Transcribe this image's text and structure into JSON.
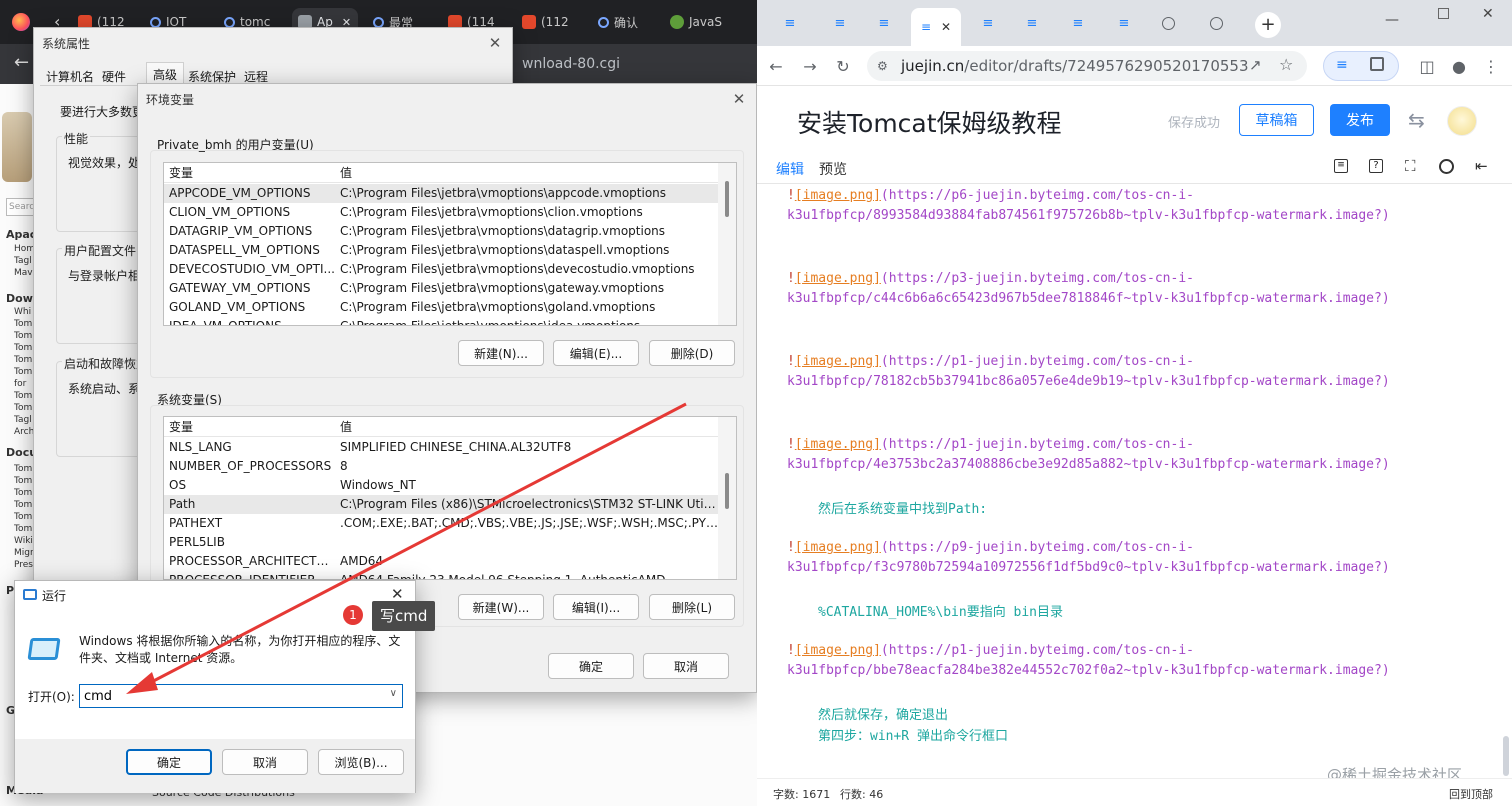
{
  "left_browser": {
    "tabs": [
      {
        "label": "(112",
        "icon": "c-icon"
      },
      {
        "label": "IOT",
        "icon": "g-icon"
      },
      {
        "label": "tomc",
        "icon": "g-icon"
      },
      {
        "label": "Ap",
        "icon": "page-icon"
      },
      {
        "label": "最常",
        "icon": "g-icon"
      },
      {
        "label": "(114",
        "icon": "c-icon"
      },
      {
        "label": "(112",
        "icon": "c-icon"
      },
      {
        "label": "确认",
        "icon": "g-icon"
      },
      {
        "label": "JavaS",
        "icon": "java-icon"
      }
    ],
    "address_fragment": "wnload-80.cgi",
    "sidebar_text": [
      "Apac",
      "Hom",
      "Tagl",
      "Mav",
      "Dow",
      "Whi",
      "Tom",
      "Tom",
      "Tom",
      "Tom",
      "Tom",
      "for",
      "Tom",
      "Tom",
      "Tagl",
      "Arch",
      "Docu",
      "Tom",
      "Tom",
      "Tom",
      "Tom",
      "Tom",
      "Tom",
      "Wiki",
      "Migr",
      "Pres",
      "P",
      "G",
      "Media"
    ],
    "search_placeholder": "Searc",
    "footer_fragment": "Source Code Distributions"
  },
  "system_properties": {
    "title": "系统属性",
    "tabs": [
      "计算机名",
      "硬件",
      "高级",
      "系统保护",
      "远程"
    ],
    "active_tab": "高级",
    "intro": "要进行大多数更",
    "performance": {
      "label": "性能",
      "text": "视觉效果，处"
    },
    "user_profiles": {
      "label": "用户配置文件",
      "text": "与登录帐户相"
    },
    "startup": {
      "label": "启动和故障恢复",
      "text": "系统启动、系"
    }
  },
  "env_vars": {
    "title": "环境变量",
    "user_section_label": "Private_bmh 的用户变量(U)",
    "columns": [
      "变量",
      "值"
    ],
    "user_vars": [
      {
        "name": "APPCODE_VM_OPTIONS",
        "value": "C:\\Program Files\\jetbra\\vmoptions\\appcode.vmoptions",
        "selected": true
      },
      {
        "name": "CLION_VM_OPTIONS",
        "value": "C:\\Program Files\\jetbra\\vmoptions\\clion.vmoptions"
      },
      {
        "name": "DATAGRIP_VM_OPTIONS",
        "value": "C:\\Program Files\\jetbra\\vmoptions\\datagrip.vmoptions"
      },
      {
        "name": "DATASPELL_VM_OPTIONS",
        "value": "C:\\Program Files\\jetbra\\vmoptions\\dataspell.vmoptions"
      },
      {
        "name": "DEVECOSTUDIO_VM_OPTI...",
        "value": "C:\\Program Files\\jetbra\\vmoptions\\devecostudio.vmoptions"
      },
      {
        "name": "GATEWAY_VM_OPTIONS",
        "value": "C:\\Program Files\\jetbra\\vmoptions\\gateway.vmoptions"
      },
      {
        "name": "GOLAND_VM_OPTIONS",
        "value": "C:\\Program Files\\jetbra\\vmoptions\\goland.vmoptions"
      },
      {
        "name": "IDEA_VM_OPTIONS",
        "value": "C:\\Program Files\\jetbra\\vmoptions\\idea.vmoptions"
      }
    ],
    "user_buttons": {
      "new": "新建(N)...",
      "edit": "编辑(E)...",
      "delete": "删除(D)"
    },
    "system_section_label": "系统变量(S)",
    "system_vars": [
      {
        "name": "NLS_LANG",
        "value": "SIMPLIFIED CHINESE_CHINA.AL32UTF8"
      },
      {
        "name": "NUMBER_OF_PROCESSORS",
        "value": "8"
      },
      {
        "name": "OS",
        "value": "Windows_NT"
      },
      {
        "name": "Path",
        "value": "C:\\Program Files (x86)\\STMicroelectronics\\STM32 ST-LINK Utili...",
        "selected": true
      },
      {
        "name": "PATHEXT",
        "value": ".COM;.EXE;.BAT;.CMD;.VBS;.VBE;.JS;.JSE;.WSF;.WSH;.MSC;.PY;.PYW"
      },
      {
        "name": "PERL5LIB",
        "value": ""
      },
      {
        "name": "PROCESSOR_ARCHITECTURE",
        "value": "AMD64"
      },
      {
        "name": "PROCESSOR_IDENTIFIER",
        "value": "AMD64 Family 23 Model 96 Stepping 1, AuthenticAMD"
      }
    ],
    "system_buttons": {
      "new": "新建(W)...",
      "edit": "编辑(I)...",
      "delete": "删除(L)"
    },
    "ok": "确定",
    "cancel": "取消"
  },
  "run_dialog": {
    "title": "运行",
    "description": "Windows 将根据你所输入的名称，为你打开相应的程序、文件夹、文档或 Internet 资源。",
    "open_label": "打开(O):",
    "input_value": "cmd",
    "ok": "确定",
    "cancel": "取消",
    "browse": "浏览(B)..."
  },
  "annotation": {
    "badge_number": "1",
    "text": "写cmd",
    "arrow_color": "#e53935"
  },
  "right_browser": {
    "url_host": "juejin.cn",
    "url_path": "/editor/drafts/7249576290520170553",
    "title": "安装Tomcat保姆级教程",
    "save_status": "保存成功",
    "draft_button": "草稿箱",
    "publish_button": "发布",
    "tabs": {
      "edit": "编辑",
      "preview": "预览"
    },
    "content": [
      {
        "kind": "img",
        "alt": "[image.png]",
        "url1": "(https://p6-juejin.byteimg.com/tos-cn-i-",
        "url2": "k3u1fbpfcp/8993584d93884fab874561f975726b8b~tplv-k3u1fbpfcp-watermark.image?)"
      },
      {
        "kind": "img",
        "alt": "[image.png]",
        "url1": "(https://p3-juejin.byteimg.com/tos-cn-i-",
        "url2": "k3u1fbpfcp/c44c6b6a6c65423d967b5dee7818846f~tplv-k3u1fbpfcp-watermark.image?)"
      },
      {
        "kind": "img",
        "alt": "[image.png]",
        "url1": "(https://p1-juejin.byteimg.com/tos-cn-i-",
        "url2": "k3u1fbpfcp/78182cb5b37941bc86a057e6e4de9b19~tplv-k3u1fbpfcp-watermark.image?)"
      },
      {
        "kind": "img",
        "alt": "[image.png]",
        "url1": "(https://p1-juejin.byteimg.com/tos-cn-i-",
        "url2": "k3u1fbpfcp/4e3753bc2a37408886cbe3e92d85a882~tplv-k3u1fbpfcp-watermark.image?)"
      },
      {
        "kind": "text",
        "text": "然后在系统变量中找到Path:"
      },
      {
        "kind": "img",
        "alt": "[image.png]",
        "url1": "(https://p9-juejin.byteimg.com/tos-cn-i-",
        "url2": "k3u1fbpfcp/f3c9780b72594a10972556f1df5bd9c0~tplv-k3u1fbpfcp-watermark.image?)"
      },
      {
        "kind": "text",
        "text": "%CATALINA_HOME%\\bin要指向 bin目录"
      },
      {
        "kind": "img",
        "alt": "[image.png]",
        "url1": "(https://p1-juejin.byteimg.com/tos-cn-i-",
        "url2": "k3u1fbpfcp/bbe78eacfa284be382e44552c702f0a2~tplv-k3u1fbpfcp-watermark.image?)"
      },
      {
        "kind": "text",
        "text": "然后就保存，确定退出"
      },
      {
        "kind": "text",
        "text": "第四步：win+R 弹出命令行框口"
      }
    ],
    "word_count": "字数: 1671",
    "line_count": "行数: 46",
    "back_to_top": "回到顶部",
    "watermark": "@稀土掘金技术社区"
  }
}
